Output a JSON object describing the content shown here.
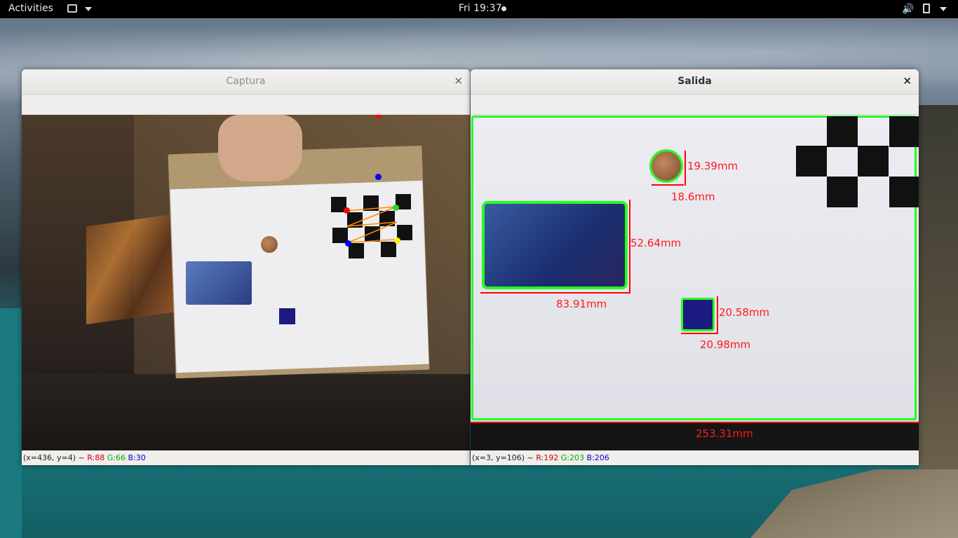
{
  "topbar": {
    "activities": "Activities",
    "clock": "Fri 19:37",
    "icons": [
      "app-menu-icon",
      "volume-icon",
      "battery-icon",
      "system-menu-arrow-icon"
    ]
  },
  "windows": {
    "left": {
      "title": "Captura",
      "close_glyph": "×",
      "status": {
        "coords": "(x=436, y=4) ~",
        "r": "R:88",
        "g": "G:66",
        "b": "B:30"
      }
    },
    "right": {
      "title": "Salida",
      "close_glyph": "×",
      "status": {
        "coords": "(x=3, y=106) ~",
        "r": "R:192",
        "g": "G:203",
        "b": "B:206"
      },
      "measurements": {
        "coin_height": "19.39mm",
        "coin_width": "18.6mm",
        "card_height": "52.64mm",
        "card_width": "83.91mm",
        "square_height": "20.58mm",
        "square_width": "20.98mm",
        "sheet_width": "253.31mm"
      }
    }
  },
  "colors": {
    "outline": "#22ff22",
    "measure": "#ff1a1a"
  }
}
